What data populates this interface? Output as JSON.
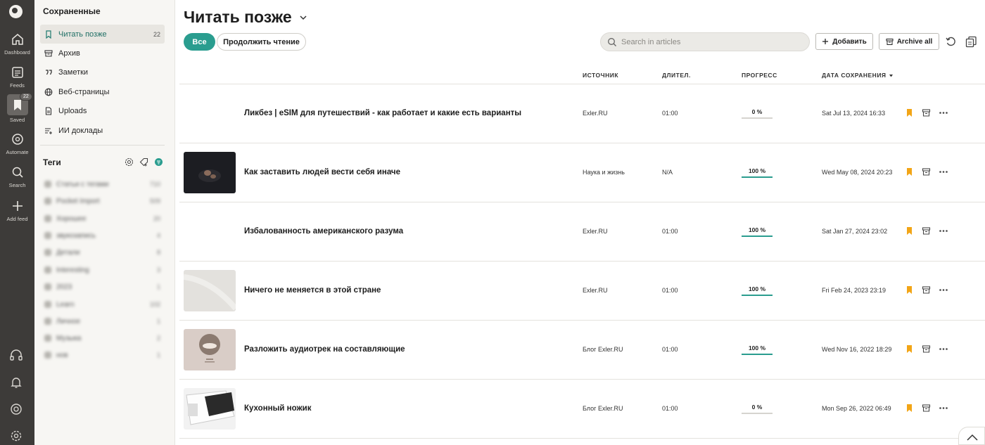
{
  "rail": {
    "items": [
      {
        "label": "Dashboard",
        "icon": "home-icon"
      },
      {
        "label": "Feeds",
        "icon": "feeds-icon"
      },
      {
        "label": "Saved",
        "icon": "bookmark-icon",
        "badge": "22"
      },
      {
        "label": "Automate",
        "icon": "automate-icon"
      },
      {
        "label": "Search",
        "icon": "search-icon"
      },
      {
        "label": "Add feed",
        "icon": "plus-icon"
      }
    ],
    "bottom_icons": [
      "headphones-icon",
      "bell-icon",
      "help-icon",
      "settings-icon"
    ]
  },
  "sidebar": {
    "title": "Сохраненные",
    "items": [
      {
        "label": "Читать позже",
        "count": "22",
        "icon": "bookmark-icon",
        "active": true
      },
      {
        "label": "Архив",
        "icon": "archive-icon"
      },
      {
        "label": "Заметки",
        "icon": "quote-icon"
      },
      {
        "label": "Веб-страницы",
        "icon": "globe-icon"
      },
      {
        "label": "Uploads",
        "icon": "document-icon"
      },
      {
        "label": "ИИ доклады",
        "icon": "ai-report-icon"
      }
    ],
    "tags_title": "Теги",
    "tags": [
      {
        "name": "Статьи с тегами",
        "count": "710"
      },
      {
        "name": "Pocket Import",
        "count": "509"
      },
      {
        "name": "Хорошее",
        "count": "20"
      },
      {
        "name": "звукозапись",
        "count": "4"
      },
      {
        "name": "Детали",
        "count": "8"
      },
      {
        "name": "Interesting",
        "count": "3"
      },
      {
        "name": "2023",
        "count": "1"
      },
      {
        "name": "Learn",
        "count": "102"
      },
      {
        "name": "Личное",
        "count": "1"
      },
      {
        "name": "Музыка",
        "count": "2"
      },
      {
        "name": "нов",
        "count": "1"
      }
    ]
  },
  "header": {
    "title": "Читать позже",
    "filters": {
      "all": "Все",
      "continue": "Продолжить чтение"
    },
    "search_placeholder": "Search in articles",
    "add_label": "Добавить",
    "archive_all_label": "Archive all"
  },
  "columns": {
    "source": "ИСТОЧНИК",
    "duration": "ДЛИТЕЛ.",
    "progress": "ПРОГРЕСС",
    "saved": "ДАТА СОХРАНЕНИЯ"
  },
  "articles": [
    {
      "title": "Ликбез | eSIM для путешествий - как работает и какие есть варианты",
      "source": "Exler.RU",
      "duration": "01:00",
      "progress": "0 %",
      "progress_value": 0,
      "date": "Sat Jul 13, 2024 16:33",
      "thumb": "none"
    },
    {
      "title": "Как заставить людей вести себя иначе",
      "source": "Наука и жизнь",
      "duration": "N/A",
      "progress": "100 %",
      "progress_value": 100,
      "date": "Wed May 08, 2024 20:23",
      "thumb": "dark"
    },
    {
      "title": "Избалованность американского разума",
      "source": "Exler.RU",
      "duration": "01:00",
      "progress": "100 %",
      "progress_value": 100,
      "date": "Sat Jan 27, 2024 23:02",
      "thumb": "none"
    },
    {
      "title": "Ничего не меняется в этой стране",
      "source": "Exler.RU",
      "duration": "01:00",
      "progress": "100 %",
      "progress_value": 100,
      "date": "Fri Feb 24, 2023 23:19",
      "thumb": "light"
    },
    {
      "title": "Разложить аудиотрек на составляющие",
      "source": "Блог Exler.RU",
      "duration": "01:00",
      "progress": "100 %",
      "progress_value": 100,
      "date": "Wed Nov 16, 2022 18:29",
      "thumb": "beige"
    },
    {
      "title": "Кухонный ножик",
      "source": "Блог Exler.RU",
      "duration": "01:00",
      "progress": "0 %",
      "progress_value": 0,
      "date": "Mon Sep 26, 2022 06:49",
      "thumb": "knife"
    }
  ],
  "colors": {
    "accent": "#2a9d8f",
    "bookmark": "#f2a516",
    "rail": "#3d3b39"
  }
}
